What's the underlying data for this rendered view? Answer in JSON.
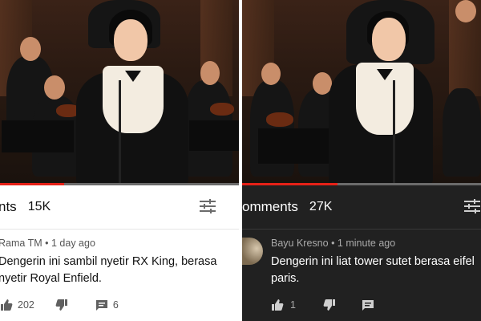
{
  "left_panel": {
    "comments_title": "nts",
    "comment_count": "15K",
    "video_progress": 0.27,
    "comment": {
      "author": "Rama TM",
      "time": "1 day ago",
      "text_line1": "Dengerin ini sambil nyetir RX King, berasa",
      "text_line2": "nyetir Royal Enfield.",
      "likes": "202",
      "replies": "6"
    }
  },
  "right_panel": {
    "comments_title": "omments",
    "comment_count": "27K",
    "video_progress": 0.4,
    "comment": {
      "author": "Bayu Kresno",
      "time": "1 minute ago",
      "text_line1": "Dengerin ini liat tower sutet berasa eifel",
      "text_line2": "paris.",
      "likes": "1"
    }
  },
  "colors": {
    "progress_red": "#e62117",
    "light_bg": "#ffffff",
    "dark_bg": "#212121"
  },
  "icons": [
    "filter-sliders-icon",
    "thumbs-up-icon",
    "thumbs-down-icon",
    "reply-comment-icon"
  ]
}
